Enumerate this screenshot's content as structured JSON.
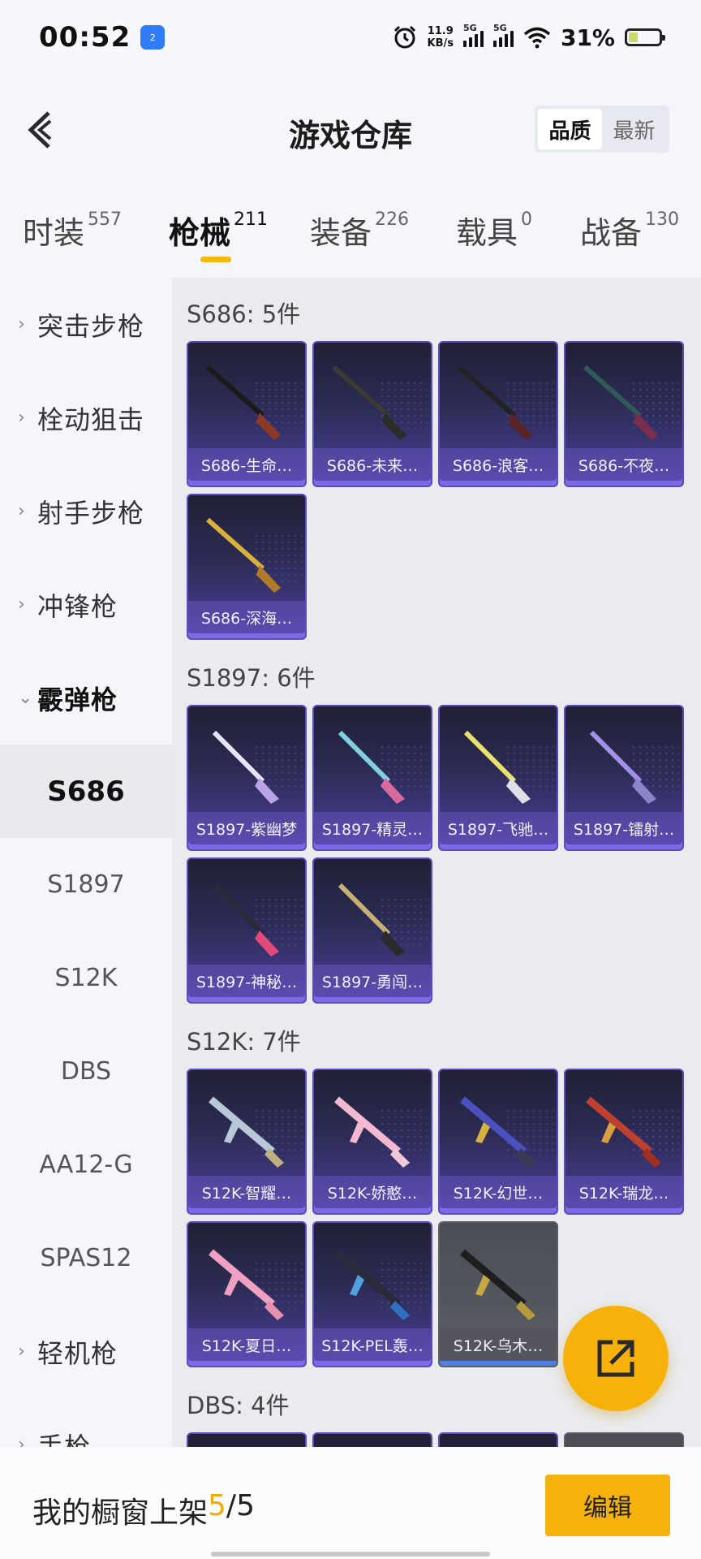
{
  "status_bar": {
    "time": "00:52",
    "hotspot_count": "2",
    "net_speed_value": "11.9",
    "net_speed_unit": "KB/s",
    "sim1": "5G",
    "sim2": "5G",
    "battery_pct": "31%"
  },
  "header": {
    "title": "游戏仓库",
    "sort_quality": "品质",
    "sort_newest": "最新"
  },
  "tabs": [
    {
      "name": "时装",
      "count": "557"
    },
    {
      "name": "枪械",
      "count": "211"
    },
    {
      "name": "装备",
      "count": "226"
    },
    {
      "name": "载具",
      "count": "0"
    },
    {
      "name": "战备",
      "count": "130"
    }
  ],
  "sidebar": {
    "categories": [
      "突击步枪",
      "栓动狙击",
      "射手步枪",
      "冲锋枪",
      "霰弹枪",
      "轻机枪",
      "手枪"
    ],
    "subs": [
      "S686",
      "S1897",
      "S12K",
      "DBS",
      "AA12-G",
      "SPAS12"
    ]
  },
  "sections": [
    {
      "title": "S686: 5件",
      "items": [
        "S686-生命…",
        "S686-未来…",
        "S686-浪客…",
        "S686-不夜…",
        "S686-深海…"
      ]
    },
    {
      "title": "S1897: 6件",
      "items": [
        "S1897-紫幽梦",
        "S1897-精灵…",
        "S1897-飞驰…",
        "S1897-镭射…",
        "S1897-神秘…",
        "S1897-勇闯…"
      ]
    },
    {
      "title": "S12K: 7件",
      "items": [
        "S12K-智耀…",
        "S12K-娇憨…",
        "S12K-幻世…",
        "S12K-瑞龙…",
        "S12K-夏日…",
        "S12K-PEL轰…",
        "S12K-乌木…"
      ]
    },
    {
      "title": "DBS: 4件",
      "items": []
    }
  ],
  "bottom": {
    "showcase_label": "我的橱窗上架",
    "showcase_used": "5",
    "showcase_sep": "/",
    "showcase_total": "5",
    "edit": "编辑"
  },
  "colors": {
    "accent": "#f6b20c",
    "card_purple": "#4a3f9a",
    "card_grey": "#5c5e66"
  }
}
